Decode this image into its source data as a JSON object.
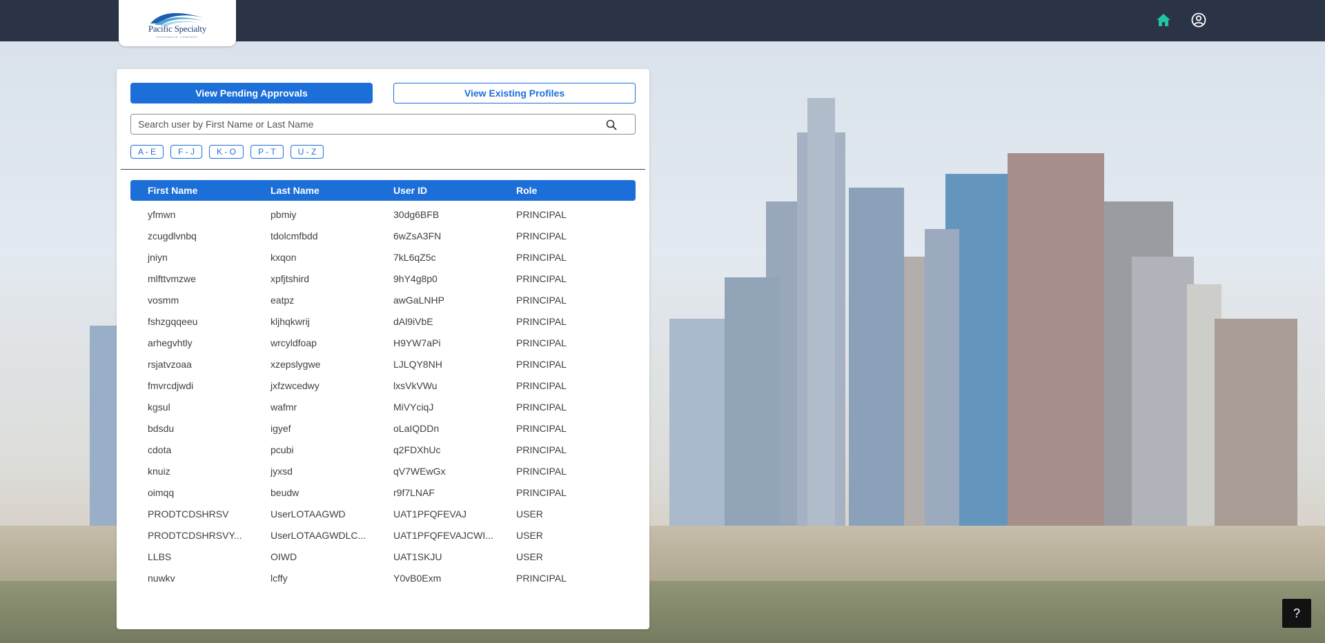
{
  "header": {
    "logo_text": "Pacific Specialty",
    "logo_subtext": "INSURANCE COMPANY",
    "home_icon": "home-icon",
    "account_icon": "account-circle-icon",
    "home_color": "#22c3a0"
  },
  "actions": {
    "pending_label": "View Pending Approvals",
    "existing_label": "View Existing Profiles"
  },
  "search": {
    "placeholder": "Search user by First Name or Last Name",
    "value": ""
  },
  "filters": [
    "A - E",
    "F - J",
    "K - O",
    "P - T",
    "U - Z"
  ],
  "table": {
    "columns": [
      "First Name",
      "Last Name",
      "User ID",
      "Role"
    ],
    "rows": [
      [
        "yfmwn",
        "pbmiy",
        "30dg6BFB",
        "PRINCIPAL"
      ],
      [
        "zcugdlvnbq",
        "tdolcmfbdd",
        "6wZsA3FN",
        "PRINCIPAL"
      ],
      [
        "jniyn",
        "kxqon",
        "7kL6qZ5c",
        "PRINCIPAL"
      ],
      [
        "mlfttvmzwe",
        "xpfjtshird",
        "9hY4g8p0",
        "PRINCIPAL"
      ],
      [
        "vosmm",
        "eatpz",
        "awGaLNHP",
        "PRINCIPAL"
      ],
      [
        "fshzgqqeeu",
        "kljhqkwrij",
        "dAl9iVbE",
        "PRINCIPAL"
      ],
      [
        "arhegvhtly",
        "wrcyldfoap",
        "H9YW7aPi",
        "PRINCIPAL"
      ],
      [
        "rsjatvzoaa",
        "xzepslygwe",
        "LJLQY8NH",
        "PRINCIPAL"
      ],
      [
        "fmvrcdjwdi",
        "jxfzwcedwy",
        "lxsVkVWu",
        "PRINCIPAL"
      ],
      [
        "kgsul",
        "wafmr",
        "MiVYciqJ",
        "PRINCIPAL"
      ],
      [
        "bdsdu",
        "igyef",
        "oLaIQDDn",
        "PRINCIPAL"
      ],
      [
        "cdota",
        "pcubi",
        "q2FDXhUc",
        "PRINCIPAL"
      ],
      [
        "knuiz",
        "jyxsd",
        "qV7WEwGx",
        "PRINCIPAL"
      ],
      [
        "oimqq",
        "beudw",
        "r9f7LNAF",
        "PRINCIPAL"
      ],
      [
        "PRODTCDSHRSV",
        "UserLOTAAGWD",
        "UAT1PFQFEVAJ",
        "USER"
      ],
      [
        "PRODTCDSHRSVY...",
        "UserLOTAAGWDLC...",
        "UAT1PFQFEVAJCWI...",
        "USER"
      ],
      [
        "LLBS",
        "OIWD",
        "UAT1SKJU",
        "USER"
      ],
      [
        "nuwkv",
        "lcffy",
        "Y0vB0Exm",
        "PRINCIPAL"
      ]
    ]
  },
  "help": {
    "label": "?"
  }
}
